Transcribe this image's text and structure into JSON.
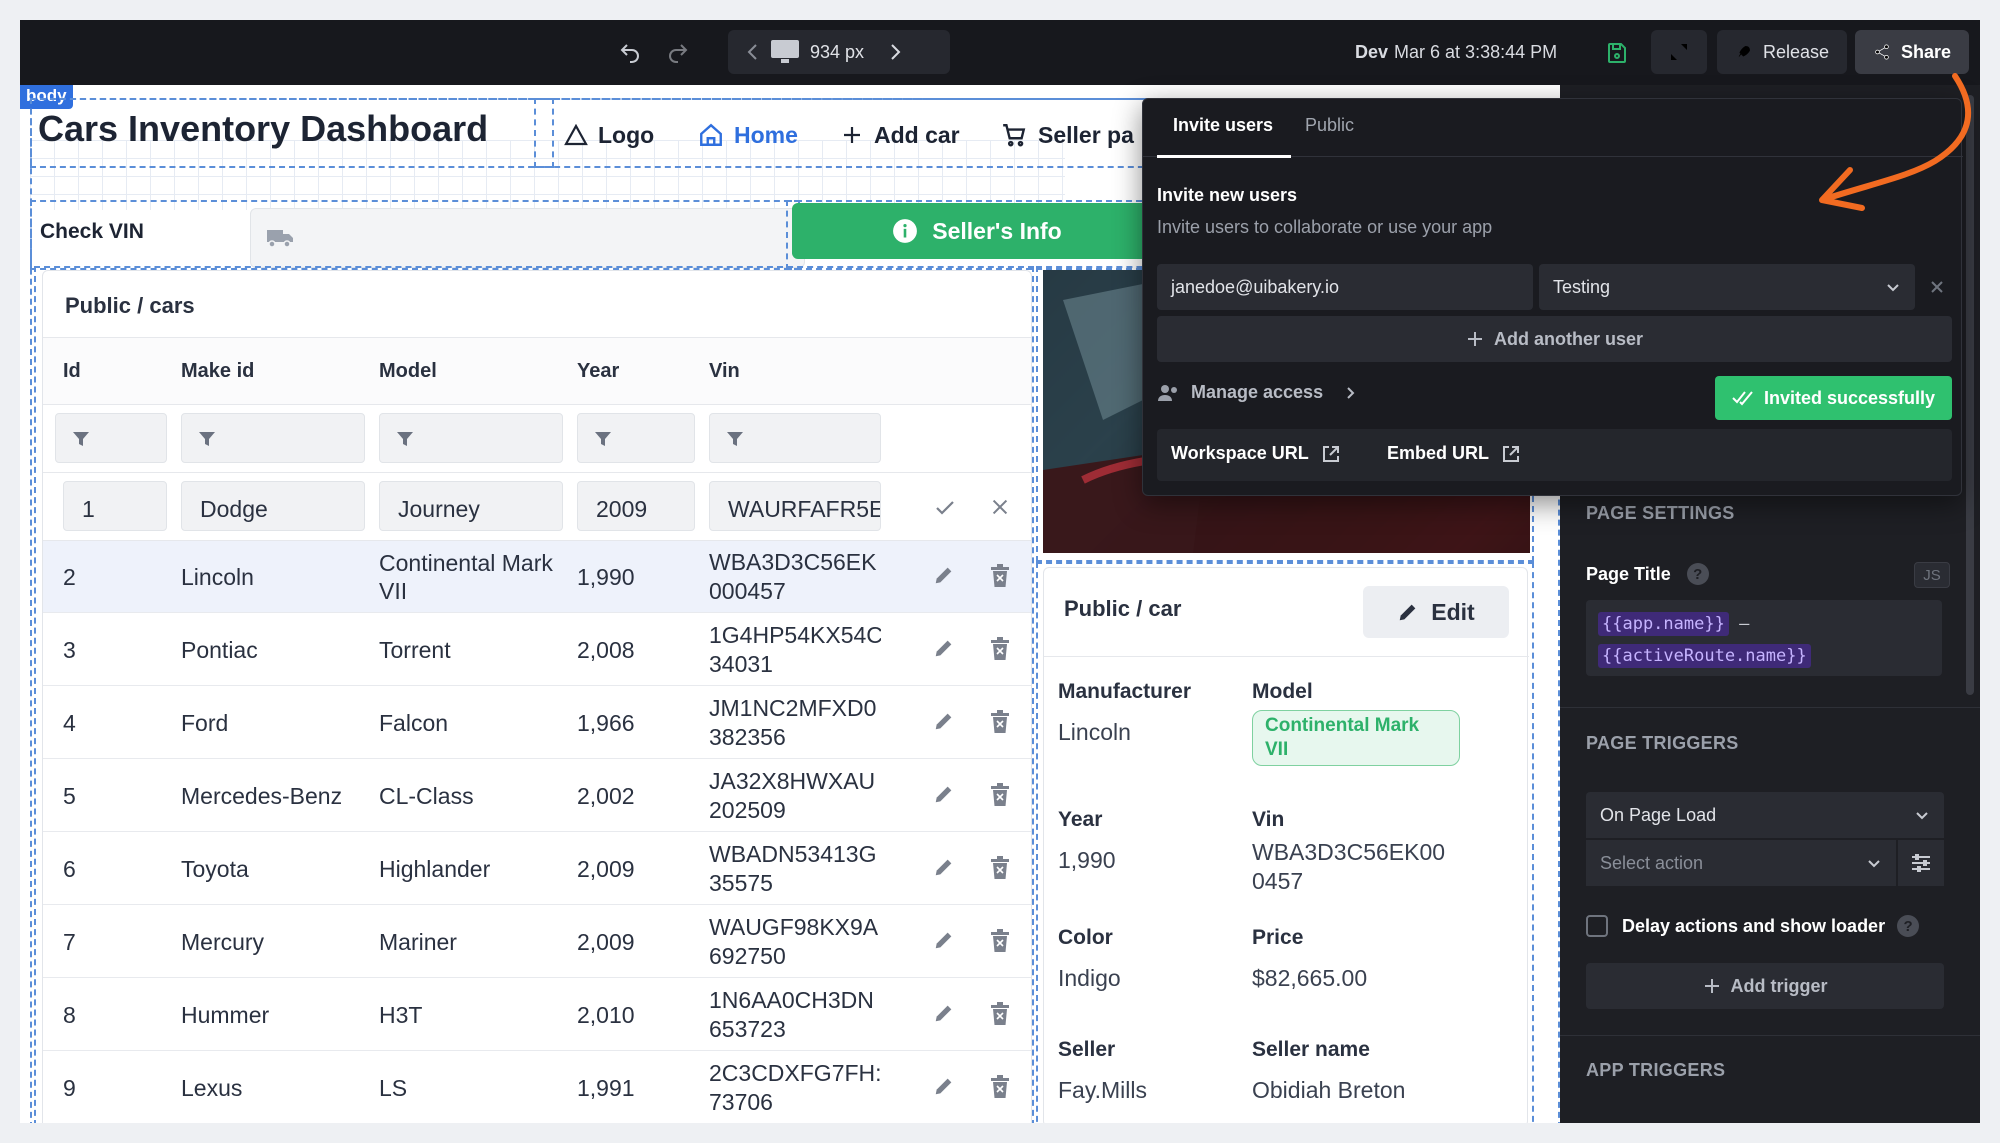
{
  "topbar": {
    "viewport": "934 px",
    "env": "Dev",
    "timestamp": "Mar 6 at 3:38:44 PM",
    "release_label": "Release",
    "share_label": "Share"
  },
  "canvas": {
    "body_tag": "body",
    "page_title": "Cars Inventory Dashboard",
    "nav": {
      "logo": "Logo",
      "home": "Home",
      "add_car": "Add car",
      "seller_page": "Seller pa"
    },
    "check_vin_label": "Check VIN",
    "sellers_info_button": "Seller's Info"
  },
  "table": {
    "title": "Public / cars",
    "columns": [
      "Id",
      "Make id",
      "Model",
      "Year",
      "Vin"
    ],
    "edit_row": {
      "id": "1",
      "make": "Dodge",
      "model": "Journey",
      "year": "2009",
      "vin": "WAURFAFR5E"
    },
    "rows": [
      {
        "id": "2",
        "make": "Lincoln",
        "model": "Continental Mark VII",
        "year": "1,990",
        "vin1": "WBA3D3C56EK",
        "vin2": "000457"
      },
      {
        "id": "3",
        "make": "Pontiac",
        "model": "Torrent",
        "year": "2,008",
        "vin1": "1G4HP54KX54C",
        "vin2": "34031"
      },
      {
        "id": "4",
        "make": "Ford",
        "model": "Falcon",
        "year": "1,966",
        "vin1": "JM1NC2MFXD0",
        "vin2": "382356"
      },
      {
        "id": "5",
        "make": "Mercedes-Benz",
        "model": "CL-Class",
        "year": "2,002",
        "vin1": "JA32X8HWXAU",
        "vin2": "202509"
      },
      {
        "id": "6",
        "make": "Toyota",
        "model": "Highlander",
        "year": "2,009",
        "vin1": "WBADN53413G",
        "vin2": "35575"
      },
      {
        "id": "7",
        "make": "Mercury",
        "model": "Mariner",
        "year": "2,009",
        "vin1": "WAUGF98KX9A",
        "vin2": "692750"
      },
      {
        "id": "8",
        "make": "Hummer",
        "model": "H3T",
        "year": "2,010",
        "vin1": "1N6AA0CH3DN",
        "vin2": "653723"
      },
      {
        "id": "9",
        "make": "Lexus",
        "model": "LS",
        "year": "1,991",
        "vin1": "2C3CDXFG7FH:",
        "vin2": "73706"
      }
    ]
  },
  "detail": {
    "title": "Public / car",
    "edit_label": "Edit",
    "manufacturer_label": "Manufacturer",
    "manufacturer": "Lincoln",
    "model_label": "Model",
    "model": "Continental Mark VII",
    "year_label": "Year",
    "year": "1,990",
    "vin_label": "Vin",
    "vin1": "WBA3D3C56EK00",
    "vin2": "0457",
    "color_label": "Color",
    "color": "Indigo",
    "price_label": "Price",
    "price": "$82,665.00",
    "seller_label": "Seller",
    "seller": "Fay.Mills",
    "seller_name_label": "Seller name",
    "seller_name": "Obidiah Breton"
  },
  "share_popup": {
    "tab_invite": "Invite users",
    "tab_public": "Public",
    "heading": "Invite new users",
    "subtext": "Invite users to collaborate or use your app",
    "email_value": "janedoe@uibakery.io",
    "role_value": "Testing",
    "add_user": "Add another user",
    "manage_access": "Manage access",
    "invited_button": "Invited successfully",
    "workspace_url": "Workspace URL",
    "embed_url": "Embed URL"
  },
  "right_panel": {
    "page_settings": "PAGE SETTINGS",
    "page_title_label": "Page Title",
    "js_badge": "JS",
    "expr1": "{{app.name}}",
    "expr_sep": " – ",
    "expr2": "{{activeRoute.name}}",
    "page_triggers": "PAGE TRIGGERS",
    "trigger_event": "On Page Load",
    "select_action_placeholder": "Select action",
    "delay_label": "Delay actions and show loader",
    "add_trigger": "Add trigger",
    "app_triggers": "APP TRIGGERS"
  },
  "colors": {
    "accent_green": "#2db16a",
    "primary_blue": "#2f6fde",
    "annotation_orange": "#f26b21",
    "dark_panel": "#1e1f24"
  }
}
